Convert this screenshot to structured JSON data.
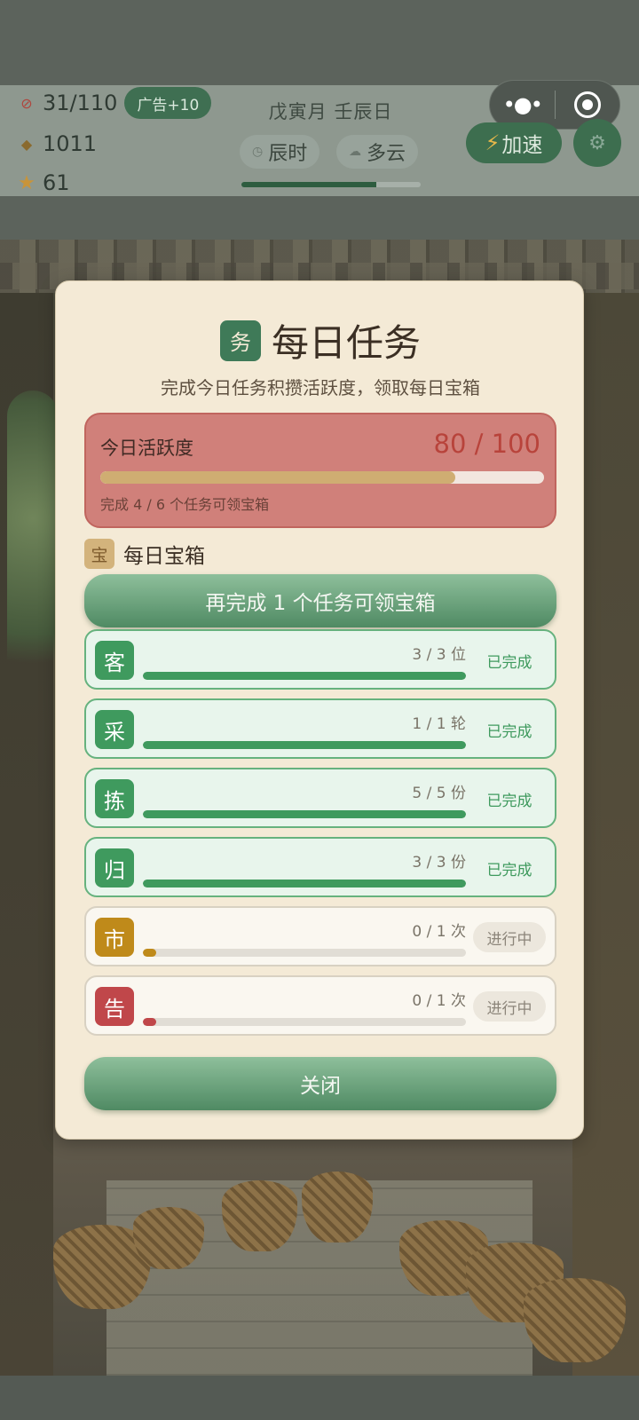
{
  "top_bar": {
    "stamina": "31/110",
    "ad_label": "广告+10",
    "coins": "1011",
    "stars": "61",
    "date": "戊寅月 壬辰日",
    "time_label": "辰时",
    "weather_label": "多云",
    "day_progress": 0.75,
    "speed_label": "加速"
  },
  "modal": {
    "title_badge": "务",
    "title": "每日任务",
    "subtitle": "完成今日任务积攒活跃度，领取每日宝箱",
    "activity": {
      "label": "今日活跃度",
      "score": "80 / 100",
      "progress": 0.8,
      "hint": "完成 4 / 6 个任务可领宝箱"
    },
    "chest": {
      "badge": "宝",
      "label": "每日宝箱",
      "button_label": "再完成 1 个任务可领宝箱"
    },
    "tasks": [
      {
        "icon": "客",
        "count": "3 / 3 位",
        "status": "已完成",
        "progress": 1.0,
        "color": "#3f9a5e"
      },
      {
        "icon": "采",
        "count": "1 / 1 轮",
        "status": "已完成",
        "progress": 1.0,
        "color": "#3f9a5e"
      },
      {
        "icon": "拣",
        "count": "5 / 5 份",
        "status": "已完成",
        "progress": 1.0,
        "color": "#3f9a5e"
      },
      {
        "icon": "归",
        "count": "3 / 3 份",
        "status": "已完成",
        "progress": 1.0,
        "color": "#3f9a5e"
      },
      {
        "icon": "市",
        "count": "0 / 1 次",
        "status": "进行中",
        "progress": 0.04,
        "color": "#bf8a1a"
      },
      {
        "icon": "告",
        "count": "0 / 1 次",
        "status": "进行中",
        "progress": 0.04,
        "color": "#c0474a"
      }
    ],
    "close_label": "关闭"
  }
}
